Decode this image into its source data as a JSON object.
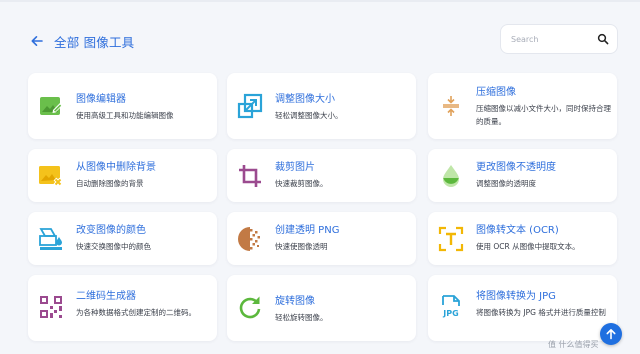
{
  "header": {
    "title": "全部 图像工具"
  },
  "search": {
    "placeholder": "Search"
  },
  "tools": [
    {
      "title": "图像编辑器",
      "desc": "使用高级工具和功能编辑图像",
      "icon": "image-edit-icon"
    },
    {
      "title": "调整图像大小",
      "desc": "轻松调整图像大小。",
      "icon": "resize-icon"
    },
    {
      "title": "压缩图像",
      "desc": "压缩图像以减小文件大小，同时保持合理的质量。",
      "icon": "compress-icon"
    },
    {
      "title": "从图像中删除背景",
      "desc": "自动删除图像的背景",
      "icon": "remove-background-icon"
    },
    {
      "title": "裁剪图片",
      "desc": "快速裁剪图像。",
      "icon": "crop-icon"
    },
    {
      "title": "更改图像不透明度",
      "desc": "调整图像的透明度",
      "icon": "opacity-icon"
    },
    {
      "title": "改变图像的颜色",
      "desc": "快速交换图像中的颜色",
      "icon": "color-change-icon"
    },
    {
      "title": "创建透明 PNG",
      "desc": "快速使图像透明",
      "icon": "transparent-png-icon"
    },
    {
      "title": "图像转文本 (OCR)",
      "desc": "使用 OCR 从图像中提取文本。",
      "icon": "ocr-icon"
    },
    {
      "title": "二维码生成器",
      "desc": "为各种数据格式创建定制的二维码。",
      "icon": "qr-code-icon"
    },
    {
      "title": "旋转图像",
      "desc": "轻松旋转图像。",
      "icon": "rotate-icon"
    },
    {
      "title": "将图像转换为 JPG",
      "desc": "将图像转换为 JPG 格式并进行质量控制",
      "icon": "jpg-convert-icon"
    }
  ],
  "watermark": "值 什么值得买",
  "colors": {
    "accent": "#2f6fdc",
    "background": "#f4f6fa",
    "card": "#ffffff",
    "fab": "#1f6fe0"
  }
}
